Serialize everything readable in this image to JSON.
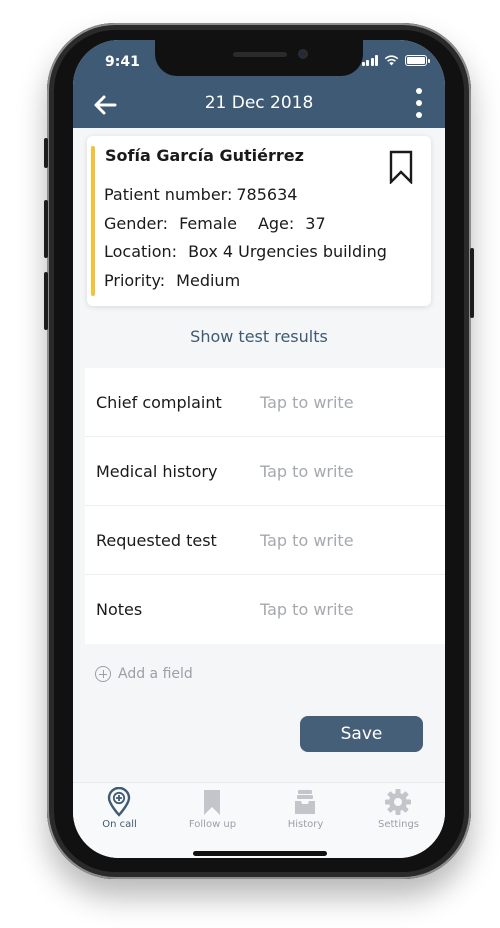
{
  "status_bar": {
    "time": "9:41"
  },
  "header": {
    "title": "21 Dec 2018"
  },
  "patient": {
    "name": "Sofía García Gutiérrez",
    "number_label": "Patient number:",
    "number": "785634",
    "gender_label": "Gender:",
    "gender": "Female",
    "age_label": "Age:",
    "age": "37",
    "location_label": "Location:",
    "location": "Box 4 Urgencies building",
    "priority_label": "Priority:",
    "priority": "Medium",
    "priority_color": "#f2c23a"
  },
  "show_results": "Show test results",
  "fields": [
    {
      "label": "Chief complaint",
      "placeholder": "Tap to write"
    },
    {
      "label": "Medical history",
      "placeholder": "Tap to write"
    },
    {
      "label": "Requested test",
      "placeholder": "Tap to write"
    },
    {
      "label": "Notes",
      "placeholder": "Tap to write"
    }
  ],
  "add_field": "Add a field",
  "save_label": "Save",
  "tabs": [
    {
      "label": "On call",
      "icon": "location-pin-plus-icon",
      "active": true
    },
    {
      "label": "Follow up",
      "icon": "bookmark-icon",
      "active": false
    },
    {
      "label": "History",
      "icon": "archive-tray-icon",
      "active": false
    },
    {
      "label": "Settings",
      "icon": "gear-icon",
      "active": false
    }
  ],
  "colors": {
    "header": "#3e5a74",
    "accent": "#465f78",
    "muted": "#9aa0a6"
  }
}
